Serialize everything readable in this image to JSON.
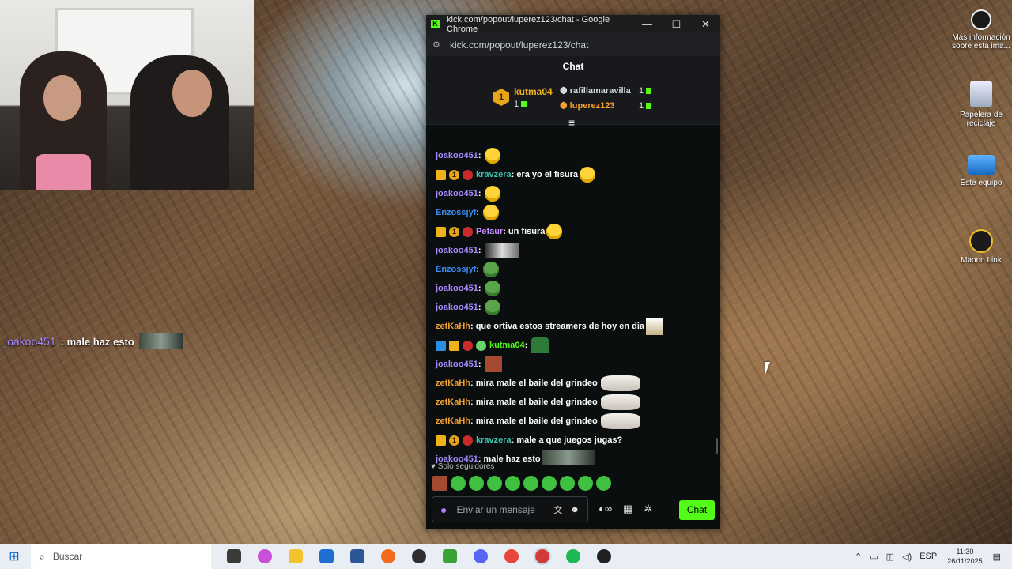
{
  "overlay": {
    "user": "joakoo451",
    "text": ": male haz esto"
  },
  "desktop_icons": [
    {
      "label": "Más información sobre esta ima..."
    },
    {
      "label": "Papelera de reciclaje"
    },
    {
      "label": "Este equipo"
    },
    {
      "label": "Maono Link"
    }
  ],
  "window": {
    "title": "kick.com/popout/luperez123/chat - Google Chrome",
    "url": "kick.com/popout/luperez123/chat",
    "minimize": "—",
    "maximize": "☐",
    "close": "✕"
  },
  "chat": {
    "header": "Chat",
    "leaderboard": {
      "first": {
        "rank": "1",
        "name": "kutma04",
        "count": "1"
      },
      "second": {
        "name": "rafillamaravilla",
        "count": "1"
      },
      "third": {
        "name": "luperez123",
        "count": "1"
      }
    },
    "messages": [
      {
        "user": "joakoo451",
        "color": "#a98bff",
        "badges": [],
        "text": "",
        "emote": "em-yellow"
      },
      {
        "user": "kravzera",
        "color": "#3cc7b0",
        "badges": [
          "b-crown",
          "b-one",
          "b-red"
        ],
        "text": "era yo el fisura",
        "emote": "em-yellow"
      },
      {
        "user": "joakoo451",
        "color": "#a98bff",
        "badges": [],
        "text": "",
        "emote": "em-yellow"
      },
      {
        "user": "Enzossjyf",
        "color": "#3a8cf0",
        "badges": [],
        "text": "",
        "emote": "em-yellow"
      },
      {
        "user": "Pefaur",
        "color": "#c78bff",
        "badges": [
          "b-crown",
          "b-one",
          "b-red"
        ],
        "text": "un fisura",
        "emote": "em-yellow"
      },
      {
        "user": "joakoo451",
        "color": "#a98bff",
        "badges": [],
        "text": "",
        "emote": "em-img"
      },
      {
        "user": "Enzossjyf",
        "color": "#3a8cf0",
        "badges": [],
        "text": "",
        "emote": "em-pepe"
      },
      {
        "user": "joakoo451",
        "color": "#a98bff",
        "badges": [],
        "text": "",
        "emote": "em-pepe"
      },
      {
        "user": "joakoo451",
        "color": "#a98bff",
        "badges": [],
        "text": "",
        "emote": "em-pepe"
      },
      {
        "user": "zetKaHh",
        "color": "#f0a030",
        "badges": [],
        "text": "que ortiva estos streamers de hoy en dia",
        "emote": "em-person"
      },
      {
        "user": "kutma04",
        "color": "#53fc18",
        "badges": [
          "b-blue",
          "b-crown",
          "b-red",
          "b-bot"
        ],
        "text": "",
        "emote": "em-green"
      },
      {
        "user": "joakoo451",
        "color": "#a98bff",
        "badges": [],
        "text": "",
        "emote": "em-red"
      },
      {
        "user": "zetKaHh",
        "color": "#f0a030",
        "badges": [],
        "text": "mira male el baile del grindeo",
        "emote": "em-dog"
      },
      {
        "user": "zetKaHh",
        "color": "#f0a030",
        "badges": [],
        "text": "mira male el baile del grindeo",
        "emote": "em-dog"
      },
      {
        "user": "zetKaHh",
        "color": "#f0a030",
        "badges": [],
        "text": "mira male el baile del grindeo",
        "emote": "em-dog"
      },
      {
        "user": "kravzera",
        "color": "#3cc7b0",
        "badges": [
          "b-crown",
          "b-one",
          "b-red"
        ],
        "text": "male a que juegos jugas?",
        "emote": ""
      },
      {
        "user": "joakoo451",
        "color": "#a98bff",
        "badges": [],
        "text": "male haz esto",
        "emote": "em-wide"
      }
    ],
    "followers_only": "Solo seguidores",
    "input_placeholder": "Enviar un mensaje",
    "send_label": "Chat"
  },
  "taskbar": {
    "search_label": "Buscar",
    "language": "ESP",
    "time": "11:30",
    "date": "26/11/2025",
    "apps": [
      {
        "name": "task-view",
        "color": "#3a3a3a"
      },
      {
        "name": "copilot",
        "color": "#c94fd8"
      },
      {
        "name": "file-explorer",
        "color": "#f4c430"
      },
      {
        "name": "store",
        "color": "#1e6fd0"
      },
      {
        "name": "word",
        "color": "#2b5797"
      },
      {
        "name": "app-orange",
        "color": "#f26a1b"
      },
      {
        "name": "obs",
        "color": "#302e31"
      },
      {
        "name": "minecraft",
        "color": "#3aa335"
      },
      {
        "name": "discord",
        "color": "#5865f2"
      },
      {
        "name": "chrome",
        "color": "#e8453c"
      },
      {
        "name": "chrome-profile",
        "color": "#d23a3a"
      },
      {
        "name": "spotify",
        "color": "#1db954"
      },
      {
        "name": "app-dark",
        "color": "#202020"
      }
    ]
  }
}
